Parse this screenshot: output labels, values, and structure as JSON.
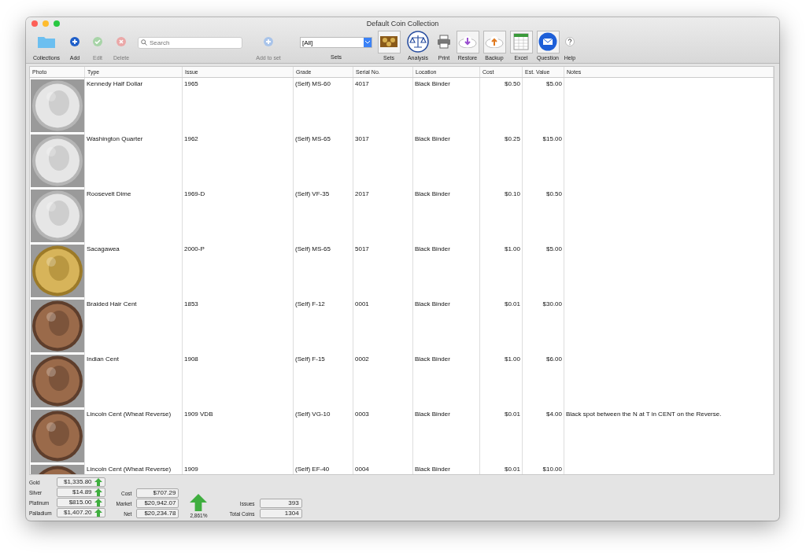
{
  "window": {
    "title": "Default Coin Collection"
  },
  "toolbar": {
    "items": [
      {
        "kind": "folder",
        "label": "Collections",
        "disabled": false
      },
      {
        "kind": "add",
        "label": "Add",
        "disabled": false
      },
      {
        "kind": "edit",
        "label": "Edit",
        "disabled": true
      },
      {
        "kind": "delete",
        "label": "Delete",
        "disabled": true
      },
      {
        "kind": "search",
        "placeholder": "Search"
      },
      {
        "kind": "add",
        "label": "Add to set",
        "disabled": true
      },
      {
        "kind": "select",
        "value": "[All]",
        "label": "Sets"
      },
      {
        "kind": "sets",
        "label": "Sets",
        "disabled": false
      },
      {
        "kind": "analysis",
        "label": "Analysis",
        "disabled": false
      },
      {
        "kind": "print",
        "label": "Print",
        "disabled": false
      },
      {
        "kind": "restore",
        "label": "Restore",
        "disabled": false
      },
      {
        "kind": "backup",
        "label": "Backup",
        "disabled": false
      },
      {
        "kind": "excel",
        "label": "Excel",
        "disabled": false
      },
      {
        "kind": "question",
        "label": "Question",
        "disabled": false
      },
      {
        "kind": "help",
        "label": "Help",
        "disabled": false
      }
    ]
  },
  "table": {
    "columns": [
      "Photo",
      "Type",
      "Issue",
      "Grade",
      "Serial No.",
      "Location",
      "Cost",
      "Est. Value",
      "Notes"
    ],
    "rows": [
      {
        "cells": [
          "",
          "Kennedy Half Dollar",
          "1965",
          "(Self) MS-60",
          "4017",
          "Black Binder",
          "$0.50",
          "$5.00",
          ""
        ]
      },
      {
        "cells": [
          "",
          "Washington Quarter",
          "1962",
          "(Self) MS-65",
          "3017",
          "Black Binder",
          "$0.25",
          "$15.00",
          ""
        ]
      },
      {
        "cells": [
          "",
          "Roosevelt Dime",
          "1969-D",
          "(Self) VF-35",
          "2017",
          "Black Binder",
          "$0.10",
          "$0.50",
          ""
        ]
      },
      {
        "cells": [
          "",
          "Sacagawea",
          "2000-P",
          "(Self) MS-65",
          "5017",
          "Black Binder",
          "$1.00",
          "$5.00",
          ""
        ]
      },
      {
        "cells": [
          "",
          "Braided Hair Cent",
          "1853",
          "(Self) F-12",
          "0001",
          "Black Binder",
          "$0.01",
          "$30.00",
          ""
        ]
      },
      {
        "cells": [
          "",
          "Indian Cent",
          "1908",
          "(Self) F-15",
          "0002",
          "Black Binder",
          "$1.00",
          "$6.00",
          ""
        ]
      },
      {
        "cells": [
          "",
          "Lincoln Cent (Wheat Reverse)",
          "1909 VDB",
          "(Self) VG-10",
          "0003",
          "Black Binder",
          "$0.01",
          "$4.00",
          "Black spot between the N at T in CENT on the Reverse."
        ]
      },
      {
        "cells": [
          "",
          "Lincoln Cent (Wheat Reverse)",
          "1909",
          "(Self) EF-40",
          "0004",
          "Black Binder",
          "$0.01",
          "$10.00",
          ""
        ]
      }
    ]
  },
  "summary": {
    "metals": [
      {
        "label": "Gold",
        "value": "$1,335.80"
      },
      {
        "label": "Silver",
        "value": "$14.89"
      },
      {
        "label": "Platinum",
        "value": "$815.00"
      },
      {
        "label": "Palladium",
        "value": "$1,407.20"
      }
    ],
    "totals": [
      {
        "label": "Cost",
        "value": "$707.29"
      },
      {
        "label": "Market",
        "value": "$20,942.07"
      },
      {
        "label": "Net",
        "value": "$20,234.78"
      }
    ],
    "gain": "2,861%",
    "counts": [
      {
        "label": "Issues",
        "value": "393"
      },
      {
        "label": "Total Coins",
        "value": "1304"
      }
    ]
  }
}
